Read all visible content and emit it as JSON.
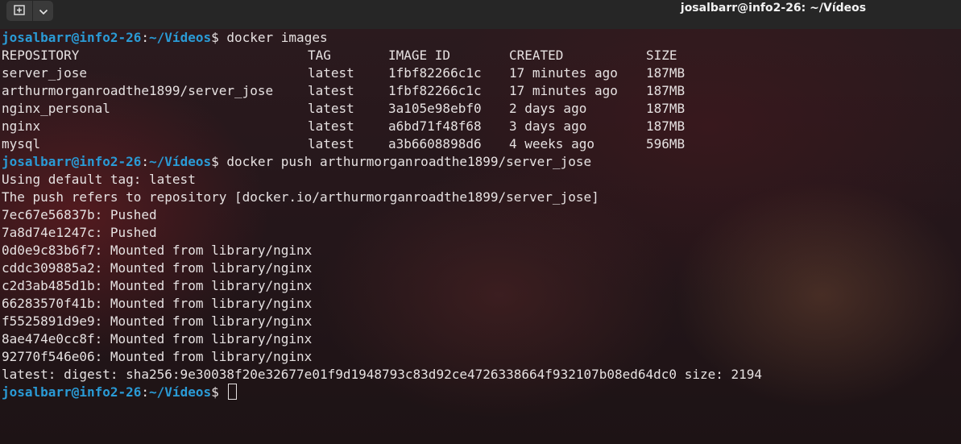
{
  "window": {
    "title": "josalbarr@info2-26: ~/Vídeos",
    "new_tab_icon": "new-tab-icon",
    "menu_icon": "chevron-down-icon"
  },
  "colors": {
    "prompt": "#2a9bd6",
    "text": "#e6e1e1",
    "titlebar": "#262626"
  },
  "prompt": {
    "user_host": "josalbarr@info2-26",
    "colon": ":",
    "path": "~/Vídeos",
    "dollar": "$ "
  },
  "commands": {
    "first": "docker images",
    "second": "docker push arthurmorganroadthe1899/server_jose"
  },
  "images_table": {
    "headers": [
      "REPOSITORY",
      "TAG",
      "IMAGE ID",
      "CREATED",
      "SIZE"
    ],
    "rows": [
      [
        "server_jose",
        "latest",
        "1fbf82266c1c",
        "17 minutes ago",
        "187MB"
      ],
      [
        "arthurmorganroadthe1899/server_jose",
        "latest",
        "1fbf82266c1c",
        "17 minutes ago",
        "187MB"
      ],
      [
        "nginx_personal",
        "latest",
        "3a105e98ebf0",
        "2 days ago",
        "187MB"
      ],
      [
        "nginx",
        "latest",
        "a6bd71f48f68",
        "3 days ago",
        "187MB"
      ],
      [
        "mysql",
        "latest",
        "a3b6608898d6",
        "4 weeks ago",
        "596MB"
      ]
    ]
  },
  "push_output": [
    "Using default tag: latest",
    "The push refers to repository [docker.io/arthurmorganroadthe1899/server_jose]",
    "7ec67e56837b: Pushed",
    "7a8d74e1247c: Pushed",
    "0d0e9c83b6f7: Mounted from library/nginx",
    "cddc309885a2: Mounted from library/nginx",
    "c2d3ab485d1b: Mounted from library/nginx",
    "66283570f41b: Mounted from library/nginx",
    "f5525891d9e9: Mounted from library/nginx",
    "8ae474e0cc8f: Mounted from library/nginx",
    "92770f546e06: Mounted from library/nginx",
    "latest: digest: sha256:9e30038f20e32677e01f9d1948793c83d92ce4726338664f932107b08ed64dc0 size: 2194"
  ]
}
